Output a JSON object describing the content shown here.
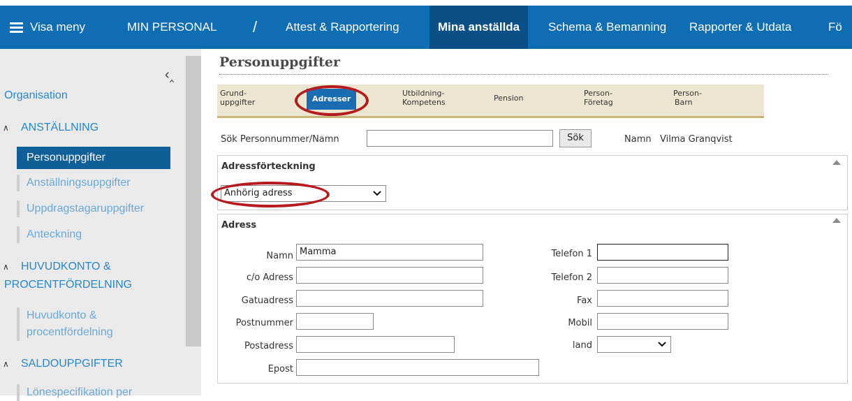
{
  "topnav": {
    "menu_label": "Visa meny",
    "app_title": "MIN PERSONAL",
    "separator": "/",
    "items": [
      "Attest & Rapportering",
      "Mina anställda",
      "Schema & Bemanning",
      "Rapporter & Utdata",
      "Fö"
    ],
    "active": "Mina anställda",
    "colors": {
      "bar": "#0f6db4",
      "active": "#0a4f86"
    }
  },
  "sidebar": {
    "collapse_icon": "chevron-left-up-icon",
    "organisation": "Organisation",
    "sections": [
      {
        "title": "ANSTÄLLNING",
        "items": [
          "Personuppgifter",
          "Anställningsuppgifter",
          "Uppdragstagaruppgifter",
          "Anteckning"
        ]
      },
      {
        "title_lines": [
          "HUVUDKONTO &",
          "PROCENTFÖRDELNING"
        ],
        "items_lines": [
          "Huvudkonto &",
          "procentfördelning"
        ]
      },
      {
        "title": "SALDOUPPGIFTER",
        "items": [
          "Lönespecifikation per"
        ]
      }
    ],
    "active_item": "Personuppgifter",
    "colors": {
      "link": "#2a87c7",
      "active_bg": "#0f5f99"
    }
  },
  "main": {
    "title": "Personuppgifter",
    "tabs": [
      {
        "l1": "Grund-",
        "l2": "uppgifter"
      },
      {
        "l1": "Adresser",
        "l2": ""
      },
      {
        "l1": "Utbildning-",
        "l2": "Kompetens"
      },
      {
        "l1": "Pension",
        "l2": ""
      },
      {
        "l1": "Person-",
        "l2": "Företag"
      },
      {
        "l1": "Person-",
        "l2": "Barn"
      }
    ],
    "active_tab": "Adresser",
    "search": {
      "label": "Sök Personnummer/Namn",
      "value": "",
      "button": "Sök",
      "name_label": "Namn",
      "name_value": "Vilma Granqvist"
    },
    "address_list": {
      "header": "Adressförteckning",
      "selected": "Anhörig adress"
    },
    "address": {
      "header": "Adress",
      "fields_left": [
        {
          "label": "Namn",
          "value": "Mamma"
        },
        {
          "label": "c/o Adress",
          "value": ""
        },
        {
          "label": "Gatuadress",
          "value": ""
        },
        {
          "label": "Postnummer",
          "value": ""
        },
        {
          "label": "Postadress",
          "value": ""
        },
        {
          "label": "Epost",
          "value": ""
        }
      ],
      "fields_right": [
        {
          "label": "Telefon 1",
          "value": ""
        },
        {
          "label": "Telefon 2",
          "value": ""
        },
        {
          "label": "Fax",
          "value": ""
        },
        {
          "label": "Mobil",
          "value": ""
        },
        {
          "label": "land",
          "value": ""
        }
      ]
    },
    "annotation_color": "#b51a1f"
  }
}
